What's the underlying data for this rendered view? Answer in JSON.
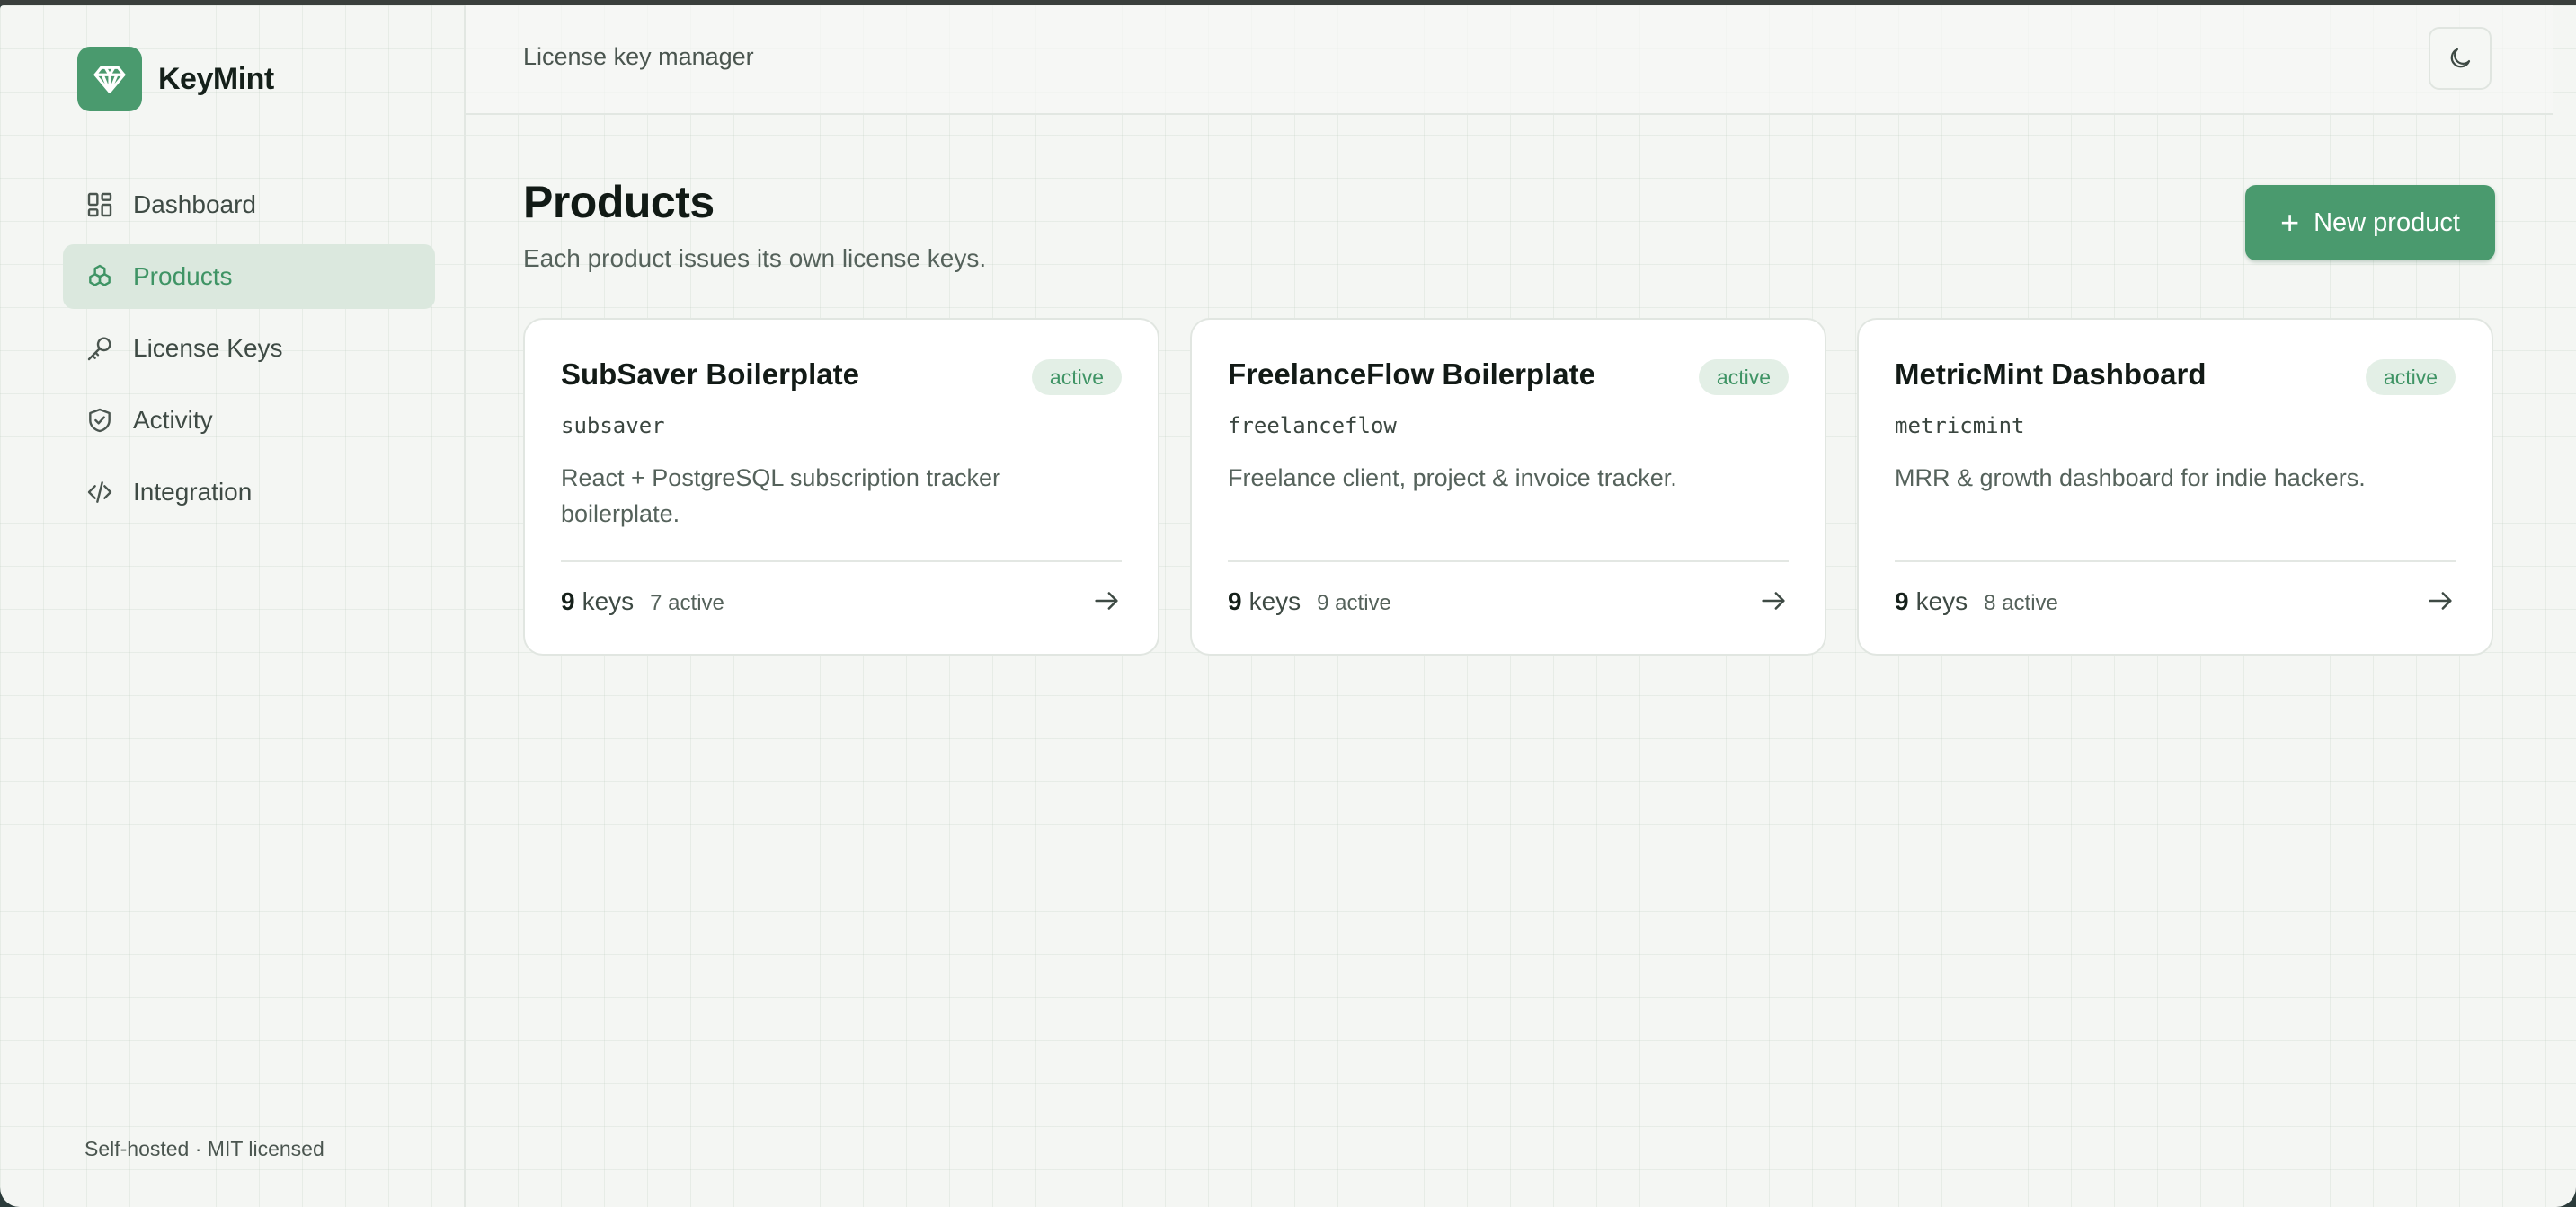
{
  "brand": {
    "name": "KeyMint",
    "accent": "#4a9a6e"
  },
  "sidebar": {
    "items": [
      {
        "label": "Dashboard",
        "icon": "dashboard-icon",
        "active": false
      },
      {
        "label": "Products",
        "icon": "products-icon",
        "active": true
      },
      {
        "label": "License Keys",
        "icon": "key-icon",
        "active": false
      },
      {
        "label": "Activity",
        "icon": "shield-icon",
        "active": false
      },
      {
        "label": "Integration",
        "icon": "code-icon",
        "active": false
      }
    ],
    "footer": "Self-hosted · MIT licensed"
  },
  "header": {
    "title": "License key manager",
    "theme_toggle_icon": "moon-icon"
  },
  "main": {
    "title": "Products",
    "subtitle": "Each product issues its own license keys.",
    "new_button": "New product"
  },
  "products": [
    {
      "name": "SubSaver Boilerplate",
      "status": "active",
      "slug": "subsaver",
      "description": "React + PostgreSQL subscription tracker boilerplate.",
      "keys": "9",
      "keys_label": "keys",
      "active_count": "7 active"
    },
    {
      "name": "FreelanceFlow Boilerplate",
      "status": "active",
      "slug": "freelanceflow",
      "description": "Freelance client, project & invoice tracker.",
      "keys": "9",
      "keys_label": "keys",
      "active_count": "9 active"
    },
    {
      "name": "MetricMint Dashboard",
      "status": "active",
      "slug": "metricmint",
      "description": "MRR & growth dashboard for indie hackers.",
      "keys": "9",
      "keys_label": "keys",
      "active_count": "8 active"
    }
  ]
}
